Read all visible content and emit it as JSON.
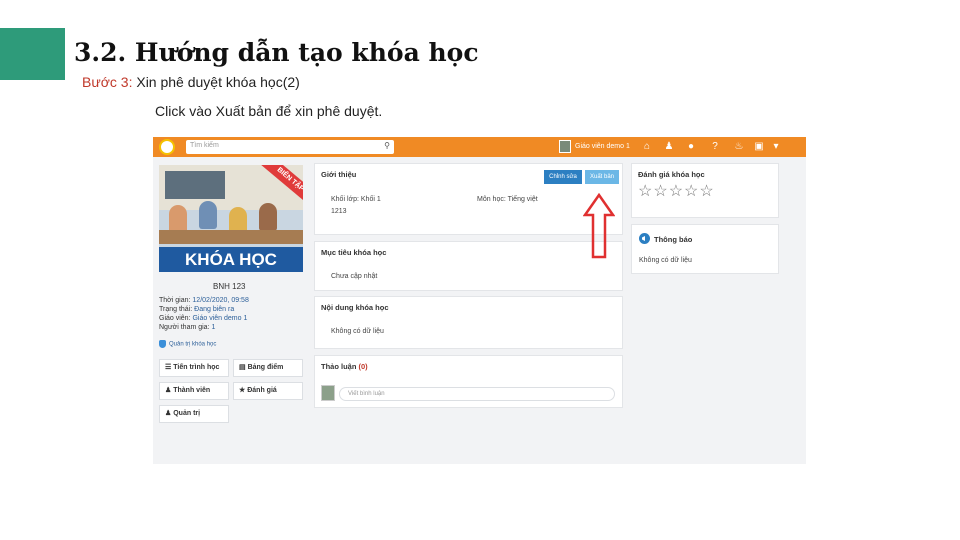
{
  "slide": {
    "title": "3.2. Hướng dẫn tạo khóa học",
    "step_label": "Bước 3:",
    "step_text": " Xin phê duyệt khóa học(2)",
    "instruction": "Click vào Xuất bản để xin phê duyệt.",
    "accent_color": "#2e9b7a"
  },
  "app": {
    "brand_color": "#f08a24",
    "search": {
      "placeholder": "Tìm kiếm",
      "icon": "search-icon"
    },
    "user": {
      "name": "Giáo viên demo 1"
    },
    "header_icons": [
      "home-icon",
      "people-icon",
      "chat-icon",
      "help-icon",
      "bell-icon",
      "package-icon",
      "chevron-down-icon"
    ],
    "course": {
      "ribbon": "BIÊN TẬP",
      "banner": "KHÓA HỌC",
      "code": "BNH 123",
      "meta": [
        {
          "label": "Thời gian:",
          "value": "12/02/2020, 09:58"
        },
        {
          "label": "Trạng thái:",
          "value": "Đang biên ra"
        },
        {
          "label": "Giáo viên:",
          "value": "Giáo viên demo 1"
        },
        {
          "label": "Người tham gia:",
          "value": "1"
        }
      ],
      "manage_link": "Quản trị khóa học"
    },
    "nav_buttons": [
      {
        "label": "Tiến trình học",
        "icon": "list-icon"
      },
      {
        "label": "Bảng điểm",
        "icon": "document-icon"
      },
      {
        "label": "Thành viên",
        "icon": "users-icon"
      },
      {
        "label": "Đánh giá",
        "icon": "star-icon"
      },
      {
        "label": "Quản trị",
        "icon": "people-icon"
      }
    ],
    "intro": {
      "title": "Giới thiệu",
      "edit_button": "Chỉnh sửa",
      "publish_button": "Xuất bản",
      "grade_label": "Khối lớp: Khối 1",
      "grade_value": "1213",
      "subject": "Môn học: Tiếng việt"
    },
    "goals": {
      "title": "Mục tiêu khóa học",
      "text": "Chưa cập nhật"
    },
    "content": {
      "title": "Nội dung khóa học",
      "text": "Không có dữ liệu"
    },
    "discussion": {
      "title": "Thảo luận",
      "count": "(0)",
      "placeholder": "Viết bình luận"
    },
    "rating": {
      "title": "Đánh giá khóa học",
      "stars": "☆☆☆☆☆"
    },
    "notice": {
      "title": "Thông báo",
      "text": "Không có dữ liệu"
    }
  }
}
